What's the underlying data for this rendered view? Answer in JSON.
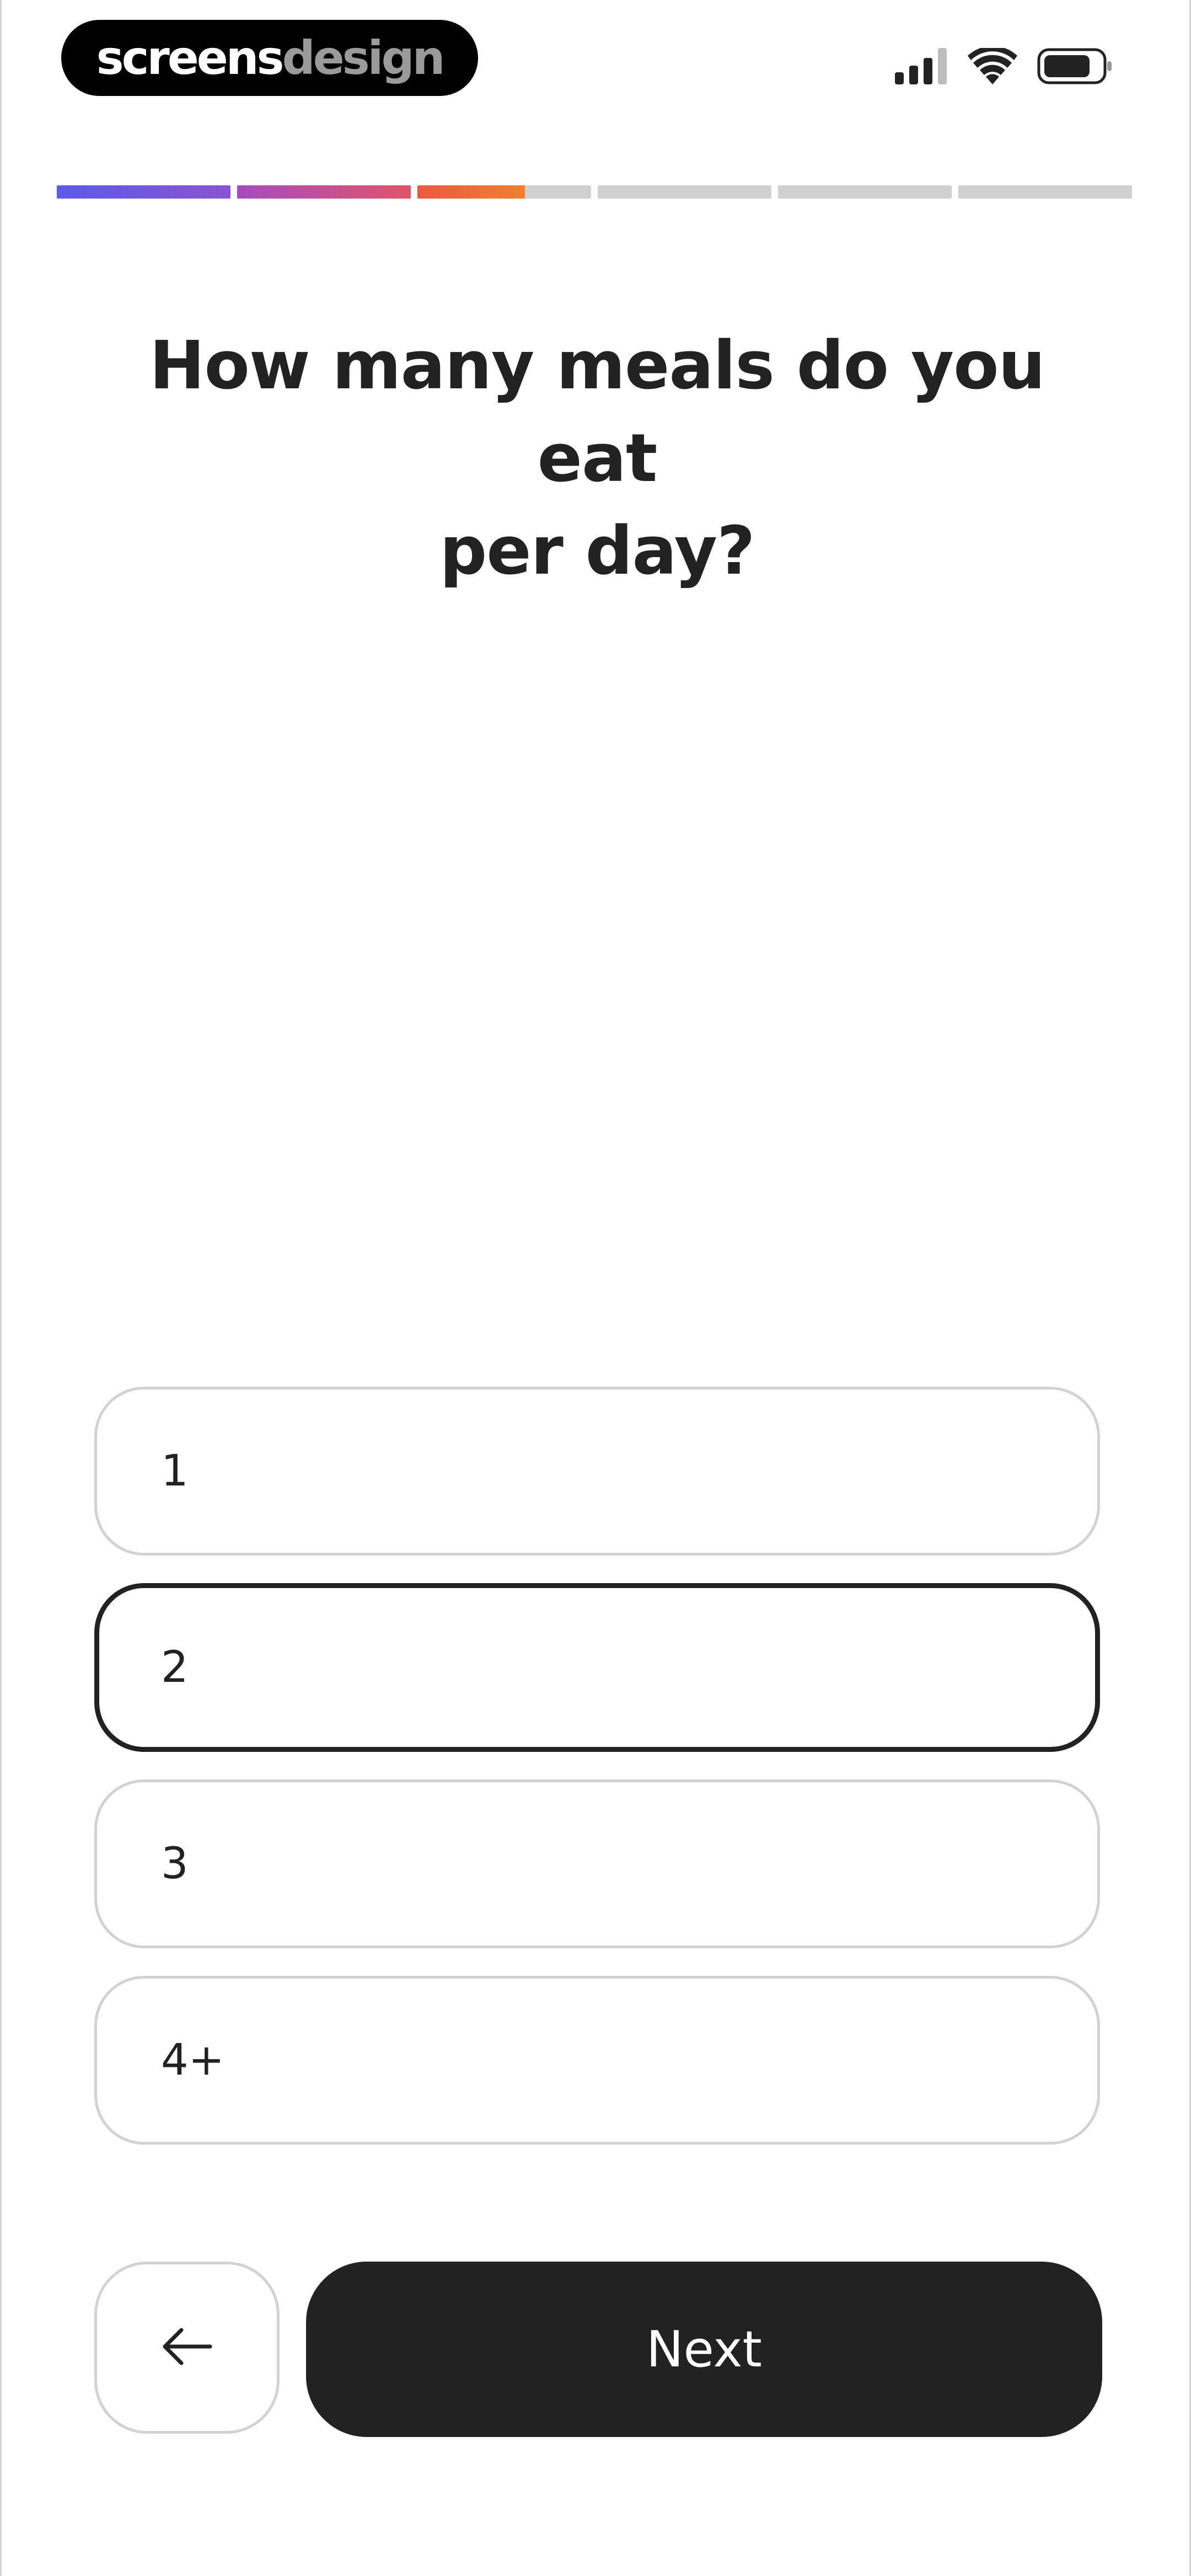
{
  "brand": {
    "part1": "screens",
    "part2": "design"
  },
  "status_bar": {
    "icons": [
      "cellular-signal-icon",
      "wifi-icon",
      "battery-icon"
    ]
  },
  "progress": {
    "total_steps": 6,
    "segments": [
      {
        "fill": 1.0,
        "color": "linear-gradient(90deg,#5b5bea,#8a54d0)"
      },
      {
        "fill": 1.0,
        "color": "linear-gradient(90deg,#a64cc0,#e0546a)"
      },
      {
        "fill": 0.62,
        "color": "linear-gradient(90deg,#ec5a40,#f08030)"
      },
      {
        "fill": 0.0,
        "color": "#d0d0d0"
      },
      {
        "fill": 0.0,
        "color": "#d0d0d0"
      },
      {
        "fill": 0.0,
        "color": "#d0d0d0"
      }
    ]
  },
  "question": {
    "line1": "How many meals do you eat",
    "line2": "per day?"
  },
  "options": [
    {
      "label": "1",
      "selected": false
    },
    {
      "label": "2",
      "selected": true
    },
    {
      "label": "3",
      "selected": false
    },
    {
      "label": "4+",
      "selected": false
    }
  ],
  "buttons": {
    "back_icon": "arrow-left-icon",
    "next_label": "Next"
  },
  "colors": {
    "text": "#222222",
    "button_dark": "#222222",
    "border_light": "#d2d2d2",
    "track": "#d0d0d0"
  }
}
